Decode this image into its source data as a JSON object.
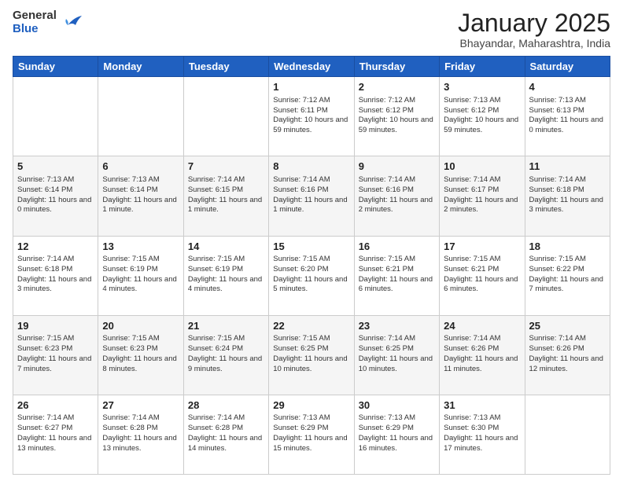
{
  "header": {
    "logo_general": "General",
    "logo_blue": "Blue",
    "title": "January 2025",
    "subtitle": "Bhayandar, Maharashtra, India"
  },
  "days_of_week": [
    "Sunday",
    "Monday",
    "Tuesday",
    "Wednesday",
    "Thursday",
    "Friday",
    "Saturday"
  ],
  "weeks": [
    [
      {
        "day": "",
        "info": ""
      },
      {
        "day": "",
        "info": ""
      },
      {
        "day": "",
        "info": ""
      },
      {
        "day": "1",
        "sunrise": "Sunrise: 7:12 AM",
        "sunset": "Sunset: 6:11 PM",
        "daylight": "Daylight: 10 hours and 59 minutes."
      },
      {
        "day": "2",
        "sunrise": "Sunrise: 7:12 AM",
        "sunset": "Sunset: 6:12 PM",
        "daylight": "Daylight: 10 hours and 59 minutes."
      },
      {
        "day": "3",
        "sunrise": "Sunrise: 7:13 AM",
        "sunset": "Sunset: 6:12 PM",
        "daylight": "Daylight: 10 hours and 59 minutes."
      },
      {
        "day": "4",
        "sunrise": "Sunrise: 7:13 AM",
        "sunset": "Sunset: 6:13 PM",
        "daylight": "Daylight: 11 hours and 0 minutes."
      }
    ],
    [
      {
        "day": "5",
        "sunrise": "Sunrise: 7:13 AM",
        "sunset": "Sunset: 6:14 PM",
        "daylight": "Daylight: 11 hours and 0 minutes."
      },
      {
        "day": "6",
        "sunrise": "Sunrise: 7:13 AM",
        "sunset": "Sunset: 6:14 PM",
        "daylight": "Daylight: 11 hours and 1 minute."
      },
      {
        "day": "7",
        "sunrise": "Sunrise: 7:14 AM",
        "sunset": "Sunset: 6:15 PM",
        "daylight": "Daylight: 11 hours and 1 minute."
      },
      {
        "day": "8",
        "sunrise": "Sunrise: 7:14 AM",
        "sunset": "Sunset: 6:16 PM",
        "daylight": "Daylight: 11 hours and 1 minute."
      },
      {
        "day": "9",
        "sunrise": "Sunrise: 7:14 AM",
        "sunset": "Sunset: 6:16 PM",
        "daylight": "Daylight: 11 hours and 2 minutes."
      },
      {
        "day": "10",
        "sunrise": "Sunrise: 7:14 AM",
        "sunset": "Sunset: 6:17 PM",
        "daylight": "Daylight: 11 hours and 2 minutes."
      },
      {
        "day": "11",
        "sunrise": "Sunrise: 7:14 AM",
        "sunset": "Sunset: 6:18 PM",
        "daylight": "Daylight: 11 hours and 3 minutes."
      }
    ],
    [
      {
        "day": "12",
        "sunrise": "Sunrise: 7:14 AM",
        "sunset": "Sunset: 6:18 PM",
        "daylight": "Daylight: 11 hours and 3 minutes."
      },
      {
        "day": "13",
        "sunrise": "Sunrise: 7:15 AM",
        "sunset": "Sunset: 6:19 PM",
        "daylight": "Daylight: 11 hours and 4 minutes."
      },
      {
        "day": "14",
        "sunrise": "Sunrise: 7:15 AM",
        "sunset": "Sunset: 6:19 PM",
        "daylight": "Daylight: 11 hours and 4 minutes."
      },
      {
        "day": "15",
        "sunrise": "Sunrise: 7:15 AM",
        "sunset": "Sunset: 6:20 PM",
        "daylight": "Daylight: 11 hours and 5 minutes."
      },
      {
        "day": "16",
        "sunrise": "Sunrise: 7:15 AM",
        "sunset": "Sunset: 6:21 PM",
        "daylight": "Daylight: 11 hours and 6 minutes."
      },
      {
        "day": "17",
        "sunrise": "Sunrise: 7:15 AM",
        "sunset": "Sunset: 6:21 PM",
        "daylight": "Daylight: 11 hours and 6 minutes."
      },
      {
        "day": "18",
        "sunrise": "Sunrise: 7:15 AM",
        "sunset": "Sunset: 6:22 PM",
        "daylight": "Daylight: 11 hours and 7 minutes."
      }
    ],
    [
      {
        "day": "19",
        "sunrise": "Sunrise: 7:15 AM",
        "sunset": "Sunset: 6:23 PM",
        "daylight": "Daylight: 11 hours and 7 minutes."
      },
      {
        "day": "20",
        "sunrise": "Sunrise: 7:15 AM",
        "sunset": "Sunset: 6:23 PM",
        "daylight": "Daylight: 11 hours and 8 minutes."
      },
      {
        "day": "21",
        "sunrise": "Sunrise: 7:15 AM",
        "sunset": "Sunset: 6:24 PM",
        "daylight": "Daylight: 11 hours and 9 minutes."
      },
      {
        "day": "22",
        "sunrise": "Sunrise: 7:15 AM",
        "sunset": "Sunset: 6:25 PM",
        "daylight": "Daylight: 11 hours and 10 minutes."
      },
      {
        "day": "23",
        "sunrise": "Sunrise: 7:14 AM",
        "sunset": "Sunset: 6:25 PM",
        "daylight": "Daylight: 11 hours and 10 minutes."
      },
      {
        "day": "24",
        "sunrise": "Sunrise: 7:14 AM",
        "sunset": "Sunset: 6:26 PM",
        "daylight": "Daylight: 11 hours and 11 minutes."
      },
      {
        "day": "25",
        "sunrise": "Sunrise: 7:14 AM",
        "sunset": "Sunset: 6:26 PM",
        "daylight": "Daylight: 11 hours and 12 minutes."
      }
    ],
    [
      {
        "day": "26",
        "sunrise": "Sunrise: 7:14 AM",
        "sunset": "Sunset: 6:27 PM",
        "daylight": "Daylight: 11 hours and 13 minutes."
      },
      {
        "day": "27",
        "sunrise": "Sunrise: 7:14 AM",
        "sunset": "Sunset: 6:28 PM",
        "daylight": "Daylight: 11 hours and 13 minutes."
      },
      {
        "day": "28",
        "sunrise": "Sunrise: 7:14 AM",
        "sunset": "Sunset: 6:28 PM",
        "daylight": "Daylight: 11 hours and 14 minutes."
      },
      {
        "day": "29",
        "sunrise": "Sunrise: 7:13 AM",
        "sunset": "Sunset: 6:29 PM",
        "daylight": "Daylight: 11 hours and 15 minutes."
      },
      {
        "day": "30",
        "sunrise": "Sunrise: 7:13 AM",
        "sunset": "Sunset: 6:29 PM",
        "daylight": "Daylight: 11 hours and 16 minutes."
      },
      {
        "day": "31",
        "sunrise": "Sunrise: 7:13 AM",
        "sunset": "Sunset: 6:30 PM",
        "daylight": "Daylight: 11 hours and 17 minutes."
      },
      {
        "day": "",
        "info": ""
      }
    ]
  ]
}
